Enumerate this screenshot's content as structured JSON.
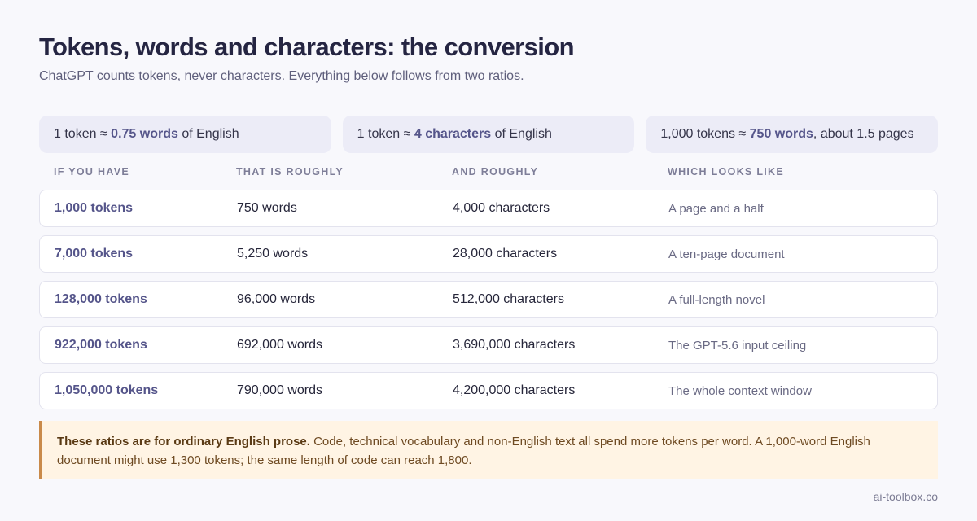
{
  "title": "Tokens, words and characters: the conversion",
  "subtitle": "ChatGPT counts tokens, never characters. Everything below follows from two ratios.",
  "ratios": [
    {
      "pre": "1 token ≈ ",
      "bold": "0.75 words",
      "post": " of English"
    },
    {
      "pre": "1 token ≈ ",
      "bold": "4 characters",
      "post": " of English"
    },
    {
      "pre": "1,000 tokens ≈ ",
      "bold": "750 words",
      "post": ", about 1.5 pages"
    }
  ],
  "table": {
    "headers": [
      "IF YOU HAVE",
      "THAT IS ROUGHLY",
      "AND ROUGHLY",
      "WHICH LOOKS LIKE"
    ],
    "rows": [
      [
        "1,000 tokens",
        "750 words",
        "4,000 characters",
        "A page and a half"
      ],
      [
        "7,000 tokens",
        "5,250 words",
        "28,000 characters",
        "A ten-page document"
      ],
      [
        "128,000 tokens",
        "96,000 words",
        "512,000 characters",
        "A full-length novel"
      ],
      [
        "922,000 tokens",
        "692,000 words",
        "3,690,000 characters",
        "The GPT-5.6 input ceiling"
      ],
      [
        "1,050,000 tokens",
        "790,000 words",
        "4,200,000 characters",
        "The whole context window"
      ]
    ]
  },
  "note": {
    "bold": "These ratios are for ordinary English prose.",
    "text": " Code, technical vocabulary and non-English text all spend more tokens per word. A 1,000-word English document might use 1,300 tokens; the same length of code can reach 1,800."
  },
  "footer": "ai-toolbox.co",
  "colors": {
    "accent": "#55558a",
    "note_border": "#c98a4a",
    "note_bg": "#fff4e4"
  }
}
